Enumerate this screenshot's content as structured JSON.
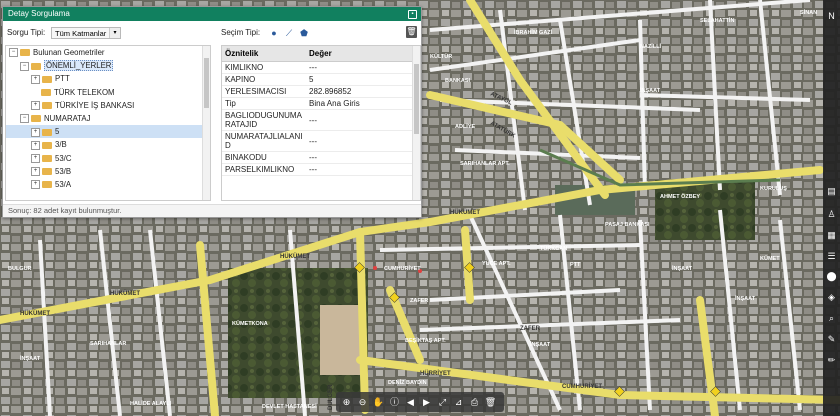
{
  "panel": {
    "title": "Detay Sorgulama"
  },
  "query": {
    "type_label": "Sorgu Tipi:",
    "type_value": "Tüm Katmanlar",
    "selection_label": "Seçim Tipi:"
  },
  "tree": {
    "root": "Bulunan Geometriler",
    "items": [
      {
        "label": "ÖNEMLİ_YERLER",
        "level": 1
      },
      {
        "label": "PTT",
        "level": 2
      },
      {
        "label": "TÜRK TELEKOM",
        "level": 2
      },
      {
        "label": "TÜRKİYE İŞ BANKASI",
        "level": 2
      },
      {
        "label": "NUMARATAJ",
        "level": 1
      },
      {
        "label": "5",
        "level": 2
      },
      {
        "label": "3/B",
        "level": 2
      },
      {
        "label": "53/C",
        "level": 2
      },
      {
        "label": "53/B",
        "level": 2
      },
      {
        "label": "53/A",
        "level": 2
      }
    ]
  },
  "attributes": {
    "header": {
      "key": "Öznitelik",
      "value": "Değer"
    },
    "rows": [
      {
        "key": "KIMLIKNO",
        "value": "---"
      },
      {
        "key": "KAPINO",
        "value": "5"
      },
      {
        "key": "YERLESIMACISI",
        "value": "282.896852"
      },
      {
        "key": "Tip",
        "value": "Bina Ana Giris"
      },
      {
        "key": "BAGLIODUGUNUMARATAJID",
        "value": "---"
      },
      {
        "key": "NUMARATAJLIALANID",
        "value": "---"
      },
      {
        "key": "BINAKODU",
        "value": "---"
      },
      {
        "key": "PARSELKIMLIKNO",
        "value": "---"
      }
    ]
  },
  "status": {
    "text": "Sonuç: 82 adet kayıt bulunmuştur."
  },
  "map": {
    "labels": {
      "a1": "İBRAHİM GAZİ",
      "a2": "ATATÜRK",
      "a3": "HÜKÜMET",
      "a4": "HÜKÜMET",
      "a5": "HÜKÜMET",
      "a6": "HÜKÜMET",
      "a7": "ZAFER",
      "a8": "TÜRKCAN",
      "a9": "CUMHURİYET",
      "a10": "HÜRRİYET",
      "a11": "CUMHURİYET",
      "a12": "NAZİLLİ",
      "a13": "SELAHATTİN",
      "a14": "KÜLTÜR",
      "a15": "ADLİYE",
      "a16": "İNŞAAT",
      "a17": "İNŞAAT",
      "a18": "PASAJ BANKASI",
      "a19": "PTT",
      "a20": "KÜMETKONA",
      "a21": "DEVLET HASTANESİ",
      "a22": "BEŞİKTAŞ APT.",
      "a23": "BULGUR",
      "a24": "DENİZ BAYDIN",
      "a25": "HALİDE ALAYLI",
      "a26": "SARIHANLAR APT.",
      "a27": "İNŞAAT",
      "a28": "KÜMET",
      "a29": "İNŞAAT",
      "a30": "İNŞAAT",
      "a31": "BANKASI",
      "a32": "SARIHANLAR",
      "a33": "DULGER",
      "a34": "ATAYOL",
      "a35": "ZAFER",
      "a36": "YÜCE APT.",
      "a37": "SİNAN",
      "a38": "AHMET ÖZBEY",
      "a39": "KURULUŞ"
    }
  }
}
